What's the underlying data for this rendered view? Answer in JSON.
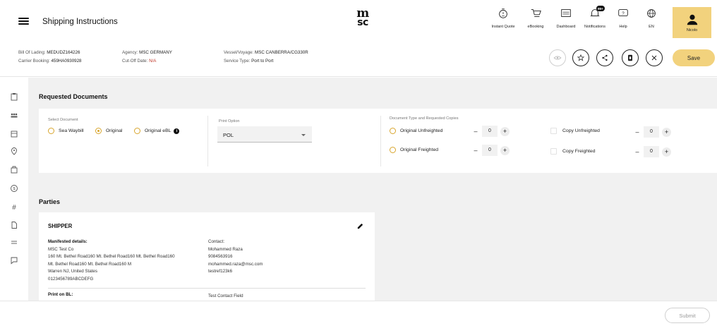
{
  "header": {
    "title": "Shipping Instructions",
    "logo_line1": "m",
    "logo_line2": "sc",
    "nav": [
      {
        "label": "Instant Quote",
        "icon": "stopwatch-icon"
      },
      {
        "label": "eBooking",
        "icon": "cart-icon"
      },
      {
        "label": "Dashboard",
        "icon": "dashboard-icon"
      },
      {
        "label": "Notifications",
        "icon": "bell-icon",
        "badge": "99+"
      },
      {
        "label": "Help",
        "icon": "help-chat-icon"
      },
      {
        "label": "EN",
        "icon": "globe-icon"
      }
    ],
    "user": {
      "label": "Nicolo",
      "icon": "user-icon"
    }
  },
  "booking": {
    "bl_label": "Bill Of Lading:",
    "bl_value": "MEDUDZ164226",
    "carrier_label": "Carrier Booking:",
    "carrier_value": "459HA0930928",
    "agency_label": "Agency:",
    "agency_value": "MSC GERMANY",
    "cutoff_label": "Cut-Off Date:",
    "cutoff_value": "N/A",
    "vessel_label": "Vessel/Voyage:",
    "vessel_value": "MSC CANBERRA/CG330R",
    "service_label": "Service Type:",
    "service_value": "Port to Port",
    "save_label": "Save"
  },
  "requested_documents": {
    "title": "Requested Documents",
    "select_document_label": "Select Document",
    "options": [
      {
        "label": "Sea Waybill",
        "checked": false
      },
      {
        "label": "Original",
        "checked": true
      },
      {
        "label": "Original eBL",
        "checked": false,
        "info": "i"
      }
    ],
    "print_option_label": "Print Option",
    "print_option_value": "POL",
    "doc_type_label": "Document Type and Requested Copies",
    "copies": [
      {
        "label": "Original Unfreighted",
        "qty": "0"
      },
      {
        "label": "Original Freighted",
        "qty": "0"
      },
      {
        "label": "Copy Unfreighted",
        "qty": "0"
      },
      {
        "label": "Copy Freighted",
        "qty": "0"
      }
    ],
    "minus_symbol": "–",
    "plus_symbol": "+"
  },
  "parties": {
    "title": "Parties",
    "shipper": {
      "title": "SHIPPER",
      "manifested_heading": "Manifested details:",
      "lines": [
        "MSC Test Co",
        "160 Mt. Bethel Road160 Mt. Bethel Road160 Mt. Bethel Road160",
        "Mt. Bethel Road160 Mt. Bethel Road160 M",
        "Warren NJ, United States",
        "0123456789ABCDEFG"
      ],
      "contact_label": "Contact:",
      "contact_lines": [
        "Mohammed Raza",
        "9084563916",
        "mohammed.raza@msc.com",
        "testref123k6"
      ],
      "print_on_bl_heading": "Print on BL:",
      "print_contact": "Test Contact Field"
    }
  },
  "footer": {
    "submit_label": "Submit"
  },
  "colors": {
    "accent": "#f2d27d",
    "radio": "#d8a52c",
    "alert": "#c0392b"
  }
}
